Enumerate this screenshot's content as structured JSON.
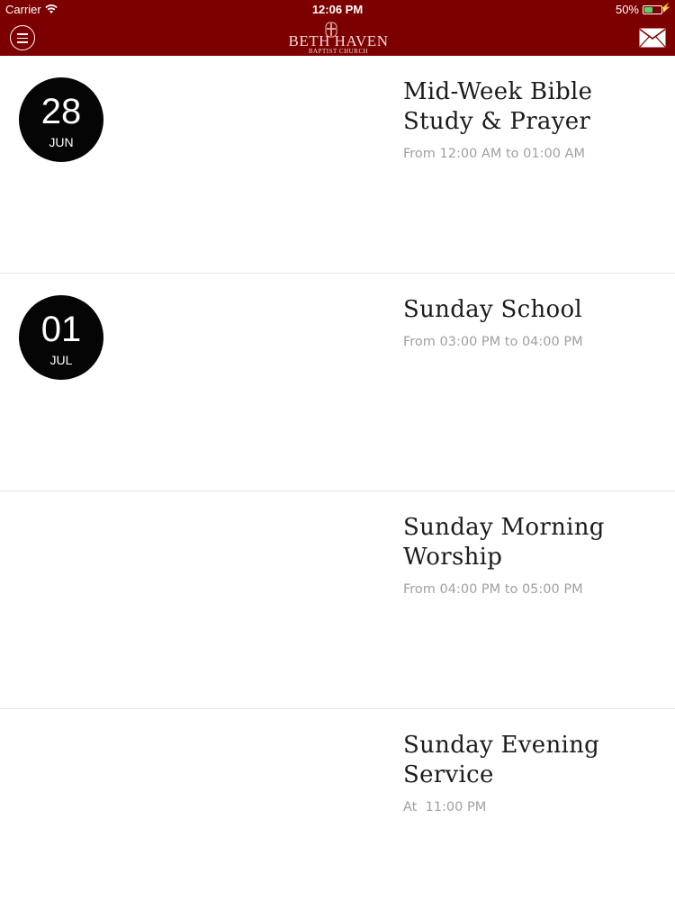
{
  "status_bar": {
    "carrier": "Carrier",
    "time": "12:06 PM",
    "battery": "50%",
    "battery_level": 0.5
  },
  "header": {
    "logo_name": "BETH HAVEN",
    "logo_subtitle": "BAPTIST CHURCH",
    "menu_icon": "menu-icon",
    "mail_icon": "mail-icon",
    "colors": {
      "bar": "#7d0000",
      "battery": "#4cd964"
    }
  },
  "events": [
    {
      "day": "28",
      "month": "JUN",
      "title": "Mid-Week Bible Study & Prayer",
      "time": "From 12:00 AM to 01:00 AM"
    },
    {
      "day": "01",
      "month": "JUL",
      "title": "Sunday School",
      "time": "From 03:00 PM to 04:00 PM"
    },
    {
      "title": "Sunday Morning Worship",
      "time": "From 04:00 PM to 05:00 PM"
    },
    {
      "title": "Sunday Evening Service",
      "time": "At  11:00 PM"
    }
  ]
}
